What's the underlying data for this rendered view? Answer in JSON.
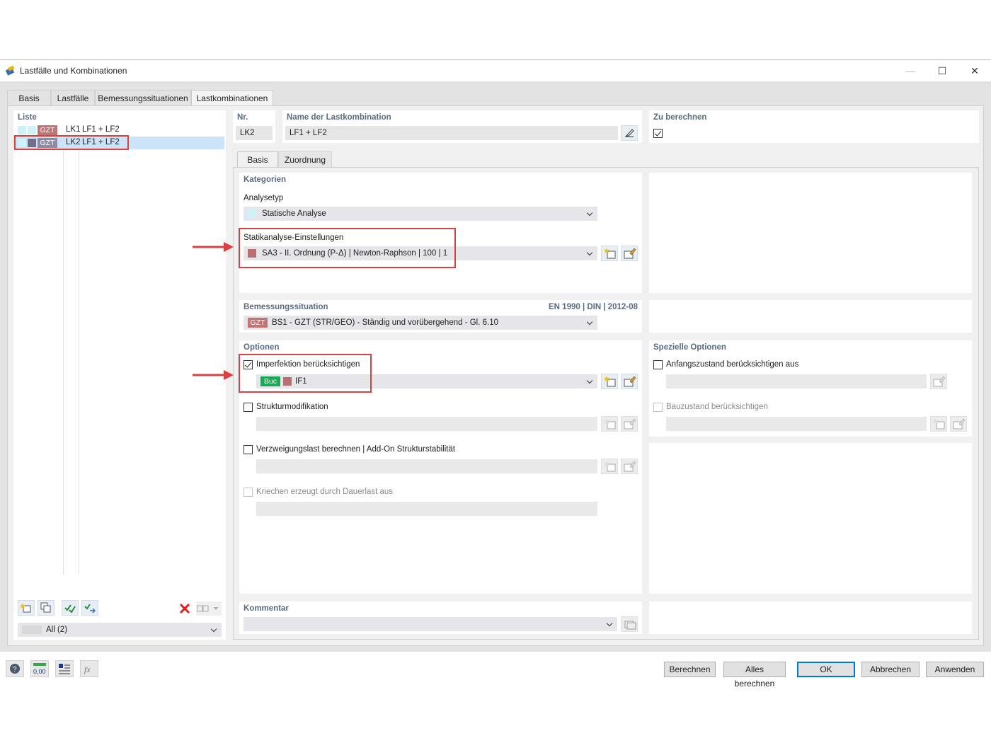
{
  "window": {
    "title": "Lastfälle und Kombinationen",
    "controls": {
      "minimize": "—",
      "maximize": "☐",
      "close": "✕"
    }
  },
  "tabs": [
    "Basis",
    "Lastfälle",
    "Bemessungssituationen",
    "Lastkombinationen"
  ],
  "active_tab": "Lastkombinationen",
  "list": {
    "title": "Liste",
    "rows": [
      {
        "tag": "GZT",
        "id": "LK1",
        "name": "LF1 + LF2"
      },
      {
        "tag": "GZT",
        "id": "LK2",
        "name": "LF1 + LF2"
      }
    ],
    "filter": "All (2)"
  },
  "header": {
    "nr_label": "Nr.",
    "nr_value": "LK2",
    "name_label": "Name der Lastkombination",
    "name_value": "LF1 + LF2",
    "compute_label": "Zu berechnen",
    "compute_checked": true
  },
  "subtabs": [
    "Basis",
    "Zuordnung"
  ],
  "kategorien": {
    "title": "Kategorien",
    "analysis_label": "Analysetyp",
    "analysis_value": "Statische Analyse",
    "settings_label": "Statikanalyse-Einstellungen",
    "settings_value": "SA3 - II. Ordnung (P-Δ) | Newton-Raphson | 100 | 1"
  },
  "bemessung": {
    "title": "Bemessungssituation",
    "norm": "EN 1990 | DIN | 2012-08",
    "tag": "GZT",
    "value": "BS1 - GZT (STR/GEO) - Ständig und vorübergehend - Gl. 6.10"
  },
  "optionen": {
    "title": "Optionen",
    "imperfection_label": "Imperfektion berücksichtigen",
    "imperfection_checked": true,
    "imperfection_tag": "Buc",
    "imperfection_value": "IF1",
    "struktur_label": "Strukturmodifikation",
    "verzweigung_label": "Verzweigungslast berechnen | Add-On Strukturstabilität",
    "kriechen_label": "Kriechen erzeugt durch Dauerlast aus"
  },
  "spezielle": {
    "title": "Spezielle Optionen",
    "anfang_label": "Anfangszustand berücksichtigen aus",
    "bauzustand_label": "Bauzustand berücksichtigen"
  },
  "kommentar": {
    "title": "Kommentar"
  },
  "footer": {
    "berechnen": "Berechnen",
    "alles": "Alles berechnen",
    "ok": "OK",
    "abbrechen": "Abbrechen",
    "anwenden": "Anwenden"
  },
  "colors": {
    "gzt": "#c27474",
    "buc": "#1aaa55",
    "annotation_red": "#d94040",
    "accent_blue": "#0078d7",
    "panel_title": "#5a6b82"
  }
}
